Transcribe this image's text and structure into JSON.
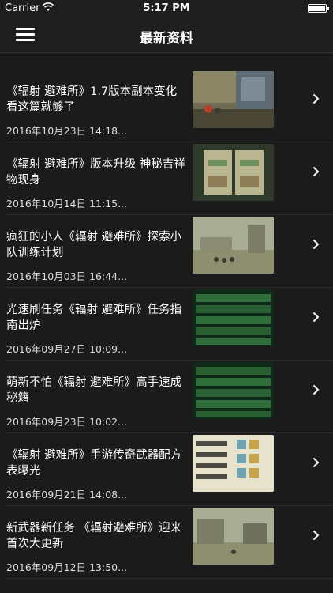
{
  "status_bar": {
    "carrier": "Carrier",
    "time": "5:17 PM"
  },
  "nav": {
    "title": "最新资料",
    "menu_icon": "hamburger-menu-icon"
  },
  "articles": [
    {
      "title": "《辐射 避难所》1.7版本副本变化看这篇就够了",
      "date": "2016年10月23日 14:18..."
    },
    {
      "title": "《辐射 避难所》版本升级 神秘吉祥物现身",
      "date": "2016年10月14日 11:15..."
    },
    {
      "title": "疯狂的小人《辐射 避难所》探索小队训练计划",
      "date": "2016年10月03日 16:44..."
    },
    {
      "title": "光速刷任务《辐射 避难所》任务指南出炉",
      "date": "2016年09月27日 10:09..."
    },
    {
      "title": "萌新不怕《辐射 避难所》高手速成秘籍",
      "date": "2016年09月23日 10:02..."
    },
    {
      "title": "《辐射 避难所》手游传奇武器配方表曝光",
      "date": "2016年09月21日 14:08..."
    },
    {
      "title": "新武器新任务 《辐射避难所》迎来首次大更新",
      "date": "2016年09月12日 13:50..."
    }
  ]
}
